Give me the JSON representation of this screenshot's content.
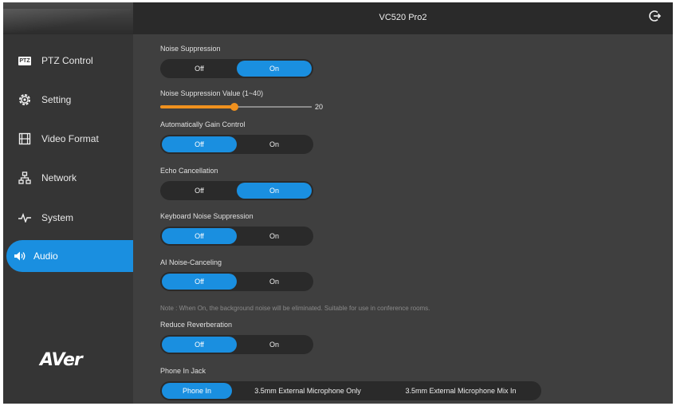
{
  "header": {
    "title": "VC520 Pro2"
  },
  "sidebar": {
    "items": [
      {
        "label": "PTZ Control",
        "icon": "ptz-icon"
      },
      {
        "label": "Setting",
        "icon": "gear-icon"
      },
      {
        "label": "Video Format",
        "icon": "film-icon"
      },
      {
        "label": "Network",
        "icon": "network-icon"
      },
      {
        "label": "System",
        "icon": "pulse-icon"
      },
      {
        "label": "Audio",
        "icon": "speaker-icon",
        "active": true
      }
    ],
    "ptz_badge": "PTZ",
    "logo": "AVer"
  },
  "audio": {
    "noise_suppression": {
      "label": "Noise Suppression",
      "off": "Off",
      "on": "On",
      "selected": "On"
    },
    "noise_suppression_value": {
      "label": "Noise Suppression Value (1~40)",
      "value": "20",
      "min": 1,
      "max": 40,
      "current": 20
    },
    "agc": {
      "label": "Automatically Gain Control",
      "off": "Off",
      "on": "On",
      "selected": "Off"
    },
    "echo": {
      "label": "Echo Cancellation",
      "off": "Off",
      "on": "On",
      "selected": "On"
    },
    "keyboard_ns": {
      "label": "Keyboard Noise Suppression",
      "off": "Off",
      "on": "On",
      "selected": "Off"
    },
    "ai_nc": {
      "label": "AI Noise-Canceling",
      "off": "Off",
      "on": "On",
      "selected": "Off"
    },
    "ai_note": "Note : When On, the background noise will be eliminated. Suitable for use in conference rooms.",
    "reverb": {
      "label": "Reduce Reverberation",
      "off": "Off",
      "on": "On",
      "selected": "Off"
    },
    "phone_jack": {
      "label": "Phone In Jack",
      "options": [
        "Phone In",
        "3.5mm External Microphone Only",
        "3.5mm External Microphone Mix In"
      ],
      "selected": "Phone In"
    }
  },
  "colors": {
    "accent": "#1a8fe0",
    "slider": "#f0911e",
    "background": "#3f3f3f",
    "sidebar": "#353535"
  }
}
